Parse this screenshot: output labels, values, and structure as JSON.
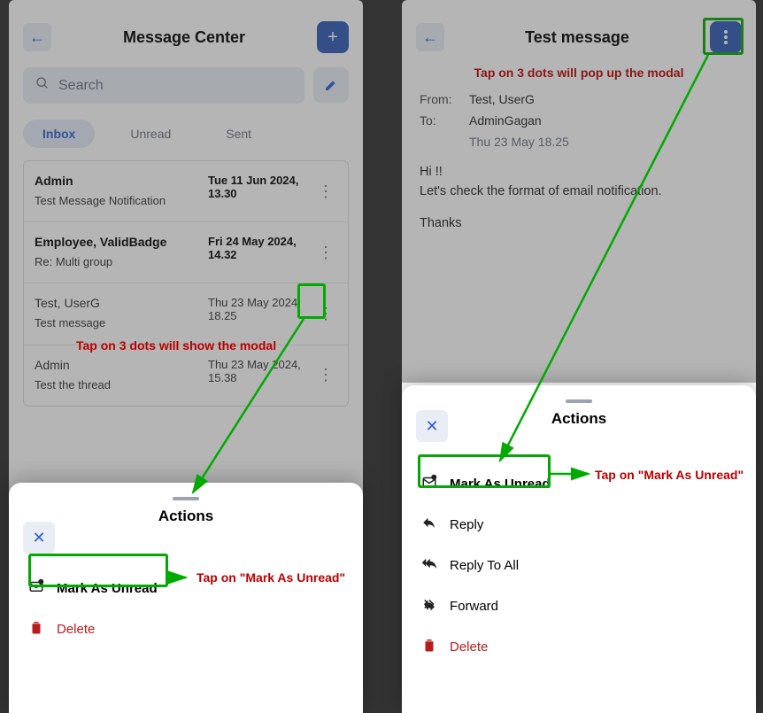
{
  "left": {
    "header": {
      "title": "Message Center"
    },
    "search_placeholder": "Search",
    "tabs": {
      "inbox": "Inbox",
      "unread": "Unread",
      "sent": "Sent"
    },
    "messages": [
      {
        "sender": "Admin",
        "subject": "Test Message Notification",
        "date": "Tue 11 Jun 2024, 13.30"
      },
      {
        "sender": "Employee, ValidBadge",
        "subject": "Re: Multi group",
        "date": "Fri 24 May 2024, 14.32"
      },
      {
        "sender": "Test, UserG",
        "subject": "Test message",
        "date": "Thu 23 May 2024, 18.25"
      },
      {
        "sender": "Admin",
        "subject": "Test the thread",
        "date": "Thu 23 May 2024, 15.38"
      }
    ],
    "modal_anno": "Tap on 3 dots will show the modal",
    "sheet": {
      "title": "Actions",
      "mark_unread": "Mark As Unread",
      "delete": "Delete"
    },
    "mark_anno": "Tap on \"Mark As Unread\""
  },
  "right": {
    "header": {
      "title": "Test message"
    },
    "top_anno": "Tap on 3 dots will pop up the modal",
    "from_lbl": "From:",
    "from_val": "Test, UserG",
    "to_lbl": "To:",
    "to_val": "AdminGagan",
    "date": "Thu 23 May 18.25",
    "body_l1": "Hi !!",
    "body_l2": "Let's check the format of email notification.",
    "body_l3": "Thanks",
    "sheet": {
      "title": "Actions",
      "mark_unread": "Mark As Unread",
      "reply": "Reply",
      "reply_all": "Reply To All",
      "forward": "Forward",
      "delete": "Delete"
    },
    "mark_anno": "Tap on \"Mark As Unread\""
  }
}
